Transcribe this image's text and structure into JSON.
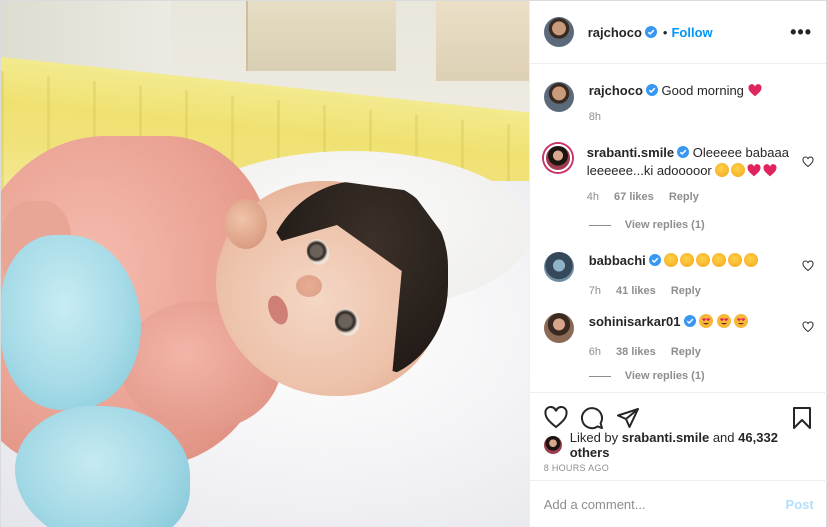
{
  "post": {
    "author": "rajchoco",
    "follow_label": "Follow",
    "separator": "•",
    "more_label": "•••",
    "photo_alt": "Newborn baby"
  },
  "caption": {
    "username": "rajchoco",
    "text": "Good morning",
    "time": "8h"
  },
  "comments": [
    {
      "username": "srabanti.smile",
      "text": "Oleeeee babaaa leeeeee...ki adooooor",
      "emojis": [
        "yum-face",
        "yum-face",
        "red-heart",
        "red-heart"
      ],
      "time": "4h",
      "likes": "67 likes",
      "reply_label": "Reply",
      "view_replies": "View replies (1)"
    },
    {
      "username": "babbachi",
      "text": "",
      "emojis": [
        "yum-face",
        "yum-face",
        "yum-face",
        "yum-face",
        "yum-face",
        "yum-face"
      ],
      "time": "7h",
      "likes": "41 likes",
      "reply_label": "Reply",
      "view_replies": ""
    },
    {
      "username": "sohinisarkar01",
      "text": "",
      "emojis": [
        "heart-eyes-face",
        "heart-eyes-face",
        "heart-eyes-face"
      ],
      "time": "6h",
      "likes": "38 likes",
      "reply_label": "Reply",
      "view_replies": "View replies (1)"
    }
  ],
  "likes_summary": {
    "prefix": "Liked by",
    "user": "srabanti.smile",
    "and": "and",
    "others": "46,332 others"
  },
  "timestamp": "8 HOURS AGO",
  "add_comment": {
    "placeholder": "Add a comment...",
    "post_label": "Post"
  },
  "colors": {
    "link": "#0095f6",
    "verified": "#3897f0",
    "heart": "#ed4956",
    "muted": "#8e8e8e",
    "post_disabled": "#b2dffc"
  }
}
